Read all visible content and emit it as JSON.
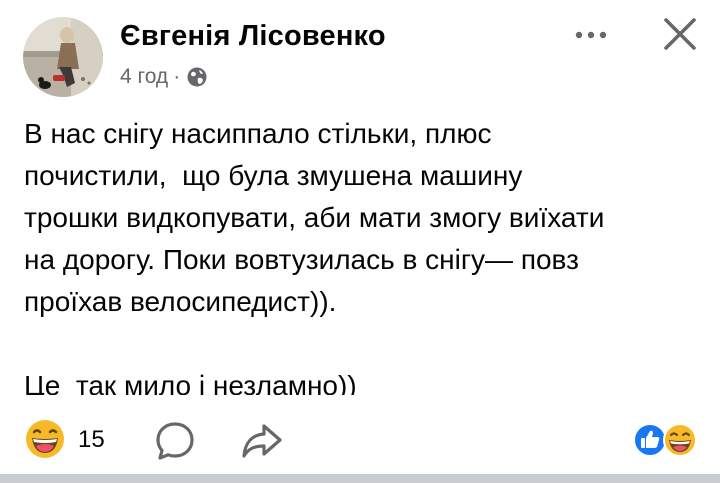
{
  "post": {
    "author": "Євгенія Лісовенко",
    "time": "4 год",
    "separator": "·",
    "privacy_icon": "globe-icon",
    "text_lines": [
      "В нас снігу насиппало стільки, плюс",
      "почистили,  що була змушена машину",
      "трошки видкопувати, аби мати змогу виїхати",
      "на дорогу. Поки вовтузилась в снігу— повз",
      "проїхав велосипедист)).",
      "",
      "Це  так мило і незламно))"
    ]
  },
  "header": {
    "more_icon": "more-horizontal-icon",
    "close_icon": "close-icon"
  },
  "footer": {
    "reaction_icon": "haha-emoji-icon",
    "reaction_count": "15",
    "comment_icon": "comment-icon",
    "share_icon": "share-icon",
    "summary_icons": [
      "like-icon",
      "haha-emoji-icon"
    ]
  },
  "colors": {
    "text": "#050505",
    "secondary": "#65676b",
    "like_blue": "#1877f2",
    "emoji_yellow": "#f7b928",
    "divider": "#c9ccd1"
  }
}
